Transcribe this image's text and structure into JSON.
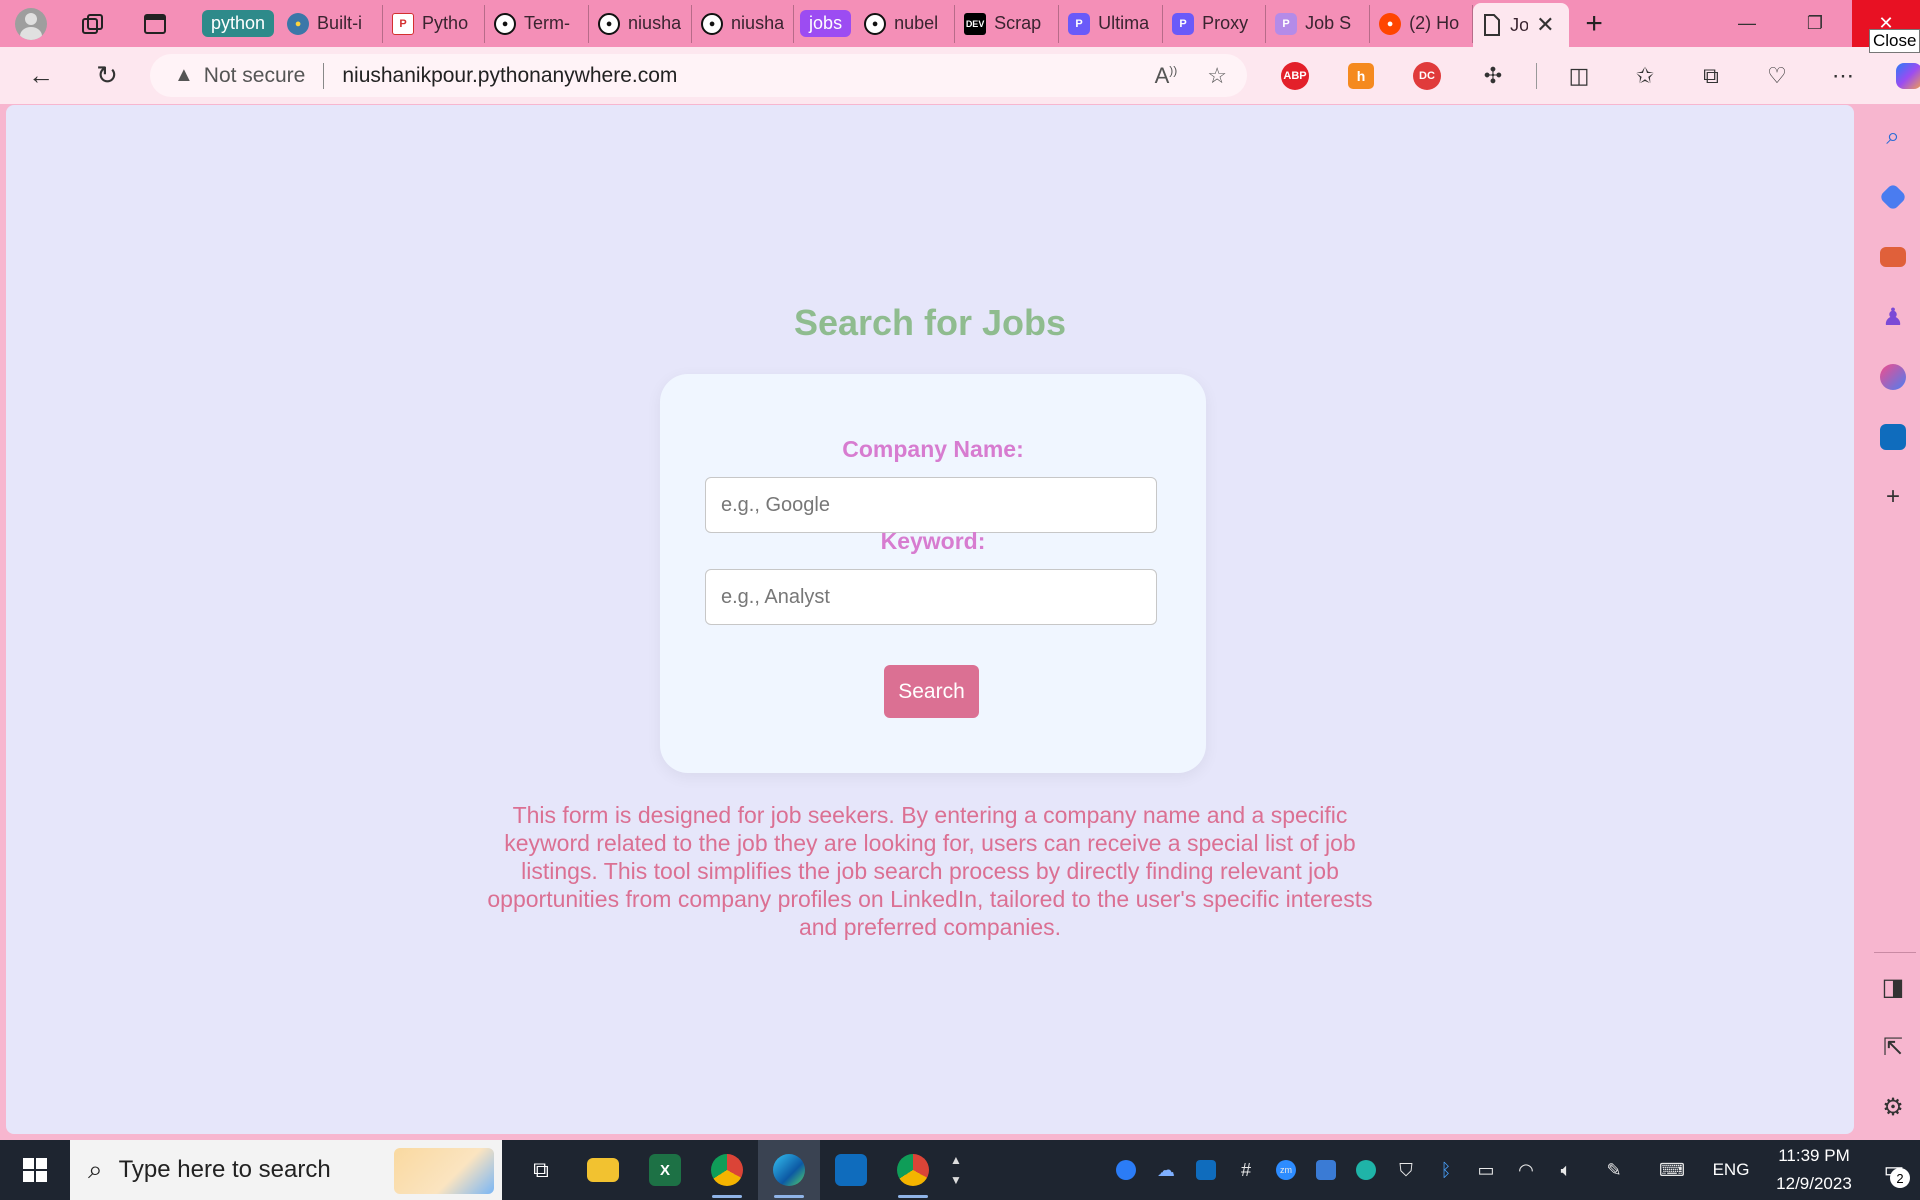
{
  "browser": {
    "tab_groups": [
      {
        "label": "python",
        "color": "#2e8a8a"
      },
      {
        "label": "jobs",
        "color": "#9c4cf2"
      }
    ],
    "tabs": [
      {
        "label": "Built-i",
        "icon": "python-icon"
      },
      {
        "label": "Pytho",
        "icon": "pdf-icon"
      },
      {
        "label": "Term-",
        "icon": "github-icon"
      },
      {
        "label": "niusha",
        "icon": "github-icon"
      },
      {
        "label": "niusha",
        "icon": "github-icon"
      },
      {
        "label": "nubel",
        "icon": "github-icon"
      },
      {
        "label": "Scrap",
        "icon": "dev-icon"
      },
      {
        "label": "Ultima",
        "icon": "proxy-icon"
      },
      {
        "label": "Proxy",
        "icon": "proxy-icon"
      },
      {
        "label": "Job S",
        "icon": "proxy-icon"
      },
      {
        "label": "(2) Ho",
        "icon": "reddit-icon"
      },
      {
        "label": "Jo",
        "icon": "page-icon"
      }
    ],
    "close_tooltip": "Close",
    "address": {
      "security_label": "Not secure",
      "url": "niushanikpour.pythonanywhere.com"
    },
    "extensions": [
      "ABP",
      "h",
      "DC"
    ]
  },
  "page": {
    "title": "Search for Jobs",
    "form": {
      "company_label": "Company Name:",
      "company_placeholder": "e.g., Google",
      "company_value": "",
      "keyword_label": "Keyword:",
      "keyword_placeholder": "e.g., Analyst",
      "keyword_value": "",
      "search_button": "Search"
    },
    "description": "This form is designed for job seekers. By entering a company name and a specific keyword related to the job they are looking for, users can receive a special list of job listings. This tool simplifies the job search process by directly finding relevant job opportunities from company profiles on LinkedIn, tailored to the user's specific interests and preferred companies."
  },
  "taskbar": {
    "search_placeholder": "Type here to search",
    "language": "ENG",
    "time": "11:39 PM",
    "date": "12/9/2023",
    "notification_count": "2",
    "app_excel_letter": "X",
    "app_zoom_letters": "zm"
  },
  "colors": {
    "title": "#8fbc8f",
    "label": "#d77cd0",
    "button": "#db7093",
    "description": "#db7093",
    "page_bg": "#e6e6fa",
    "card_bg": "#f0f6ff"
  }
}
